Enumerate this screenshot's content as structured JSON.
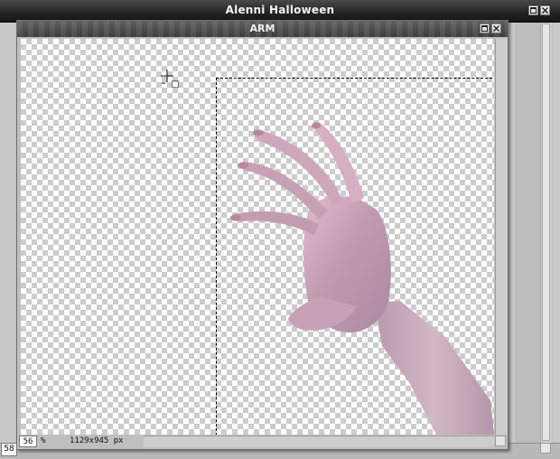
{
  "app_window": {
    "title": "Alenni Halloween",
    "zoom": "58"
  },
  "doc_window": {
    "title": "ARM",
    "zoom_value": "56",
    "zoom_unit": "%",
    "dimensions": "1129x945 px"
  },
  "icons": {
    "maximize": "maximize-icon",
    "close": "close-icon",
    "cursor": "move-crosshair-cursor-icon"
  },
  "colors": {
    "titlebar": "#222222",
    "checker_light": "#ffffff",
    "checker_dark": "#cccccc",
    "skin": "#c9a1b6"
  }
}
